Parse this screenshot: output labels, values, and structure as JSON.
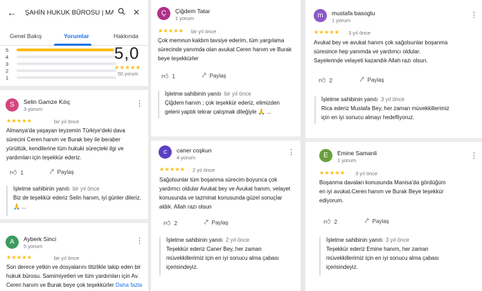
{
  "search": {
    "query": "ŞAHİN HUKUK BÜROSU | MAN"
  },
  "tabs": [
    "Genel Bakış",
    "Yorumlar",
    "Hakkında"
  ],
  "rating": {
    "score": "5,0",
    "stars": "★★★★★",
    "count": "50 yorum",
    "bars": [
      {
        "label": "5",
        "fill": 0.97
      },
      {
        "label": "4",
        "fill": 0
      },
      {
        "label": "3",
        "fill": 0
      },
      {
        "label": "2",
        "fill": 0
      },
      {
        "label": "1",
        "fill": 0
      }
    ]
  },
  "labels": {
    "like": "Beğen",
    "share": "Paylaş",
    "owner": "İşletme sahibinin yanıtı",
    "more": "Daha fazla"
  },
  "colors": {
    "accent": "#1a73e8",
    "star": "#fbbc04"
  },
  "reviews": [
    {
      "initial": "S",
      "color": "#d3457f",
      "name": "Selin Gamze Kılıç",
      "count": "3 yorum",
      "stars": "★★★★★",
      "when": "bir yıl önce",
      "text": [
        "Almanya'da yaşayan teyzemin Türkiye'deki dava",
        "sürecini Ceren hanım ve Burak bey ile beraber",
        "yürüttük, kendilerine tüm hukuki süreçteki ilgi ve",
        "yardımları için teşekkür ederiz."
      ],
      "likes": "1",
      "reply_when": "bir yıl önce",
      "reply": [
        "Biz de teşekkür ederiz Selin hanım, iyi günler dileriz.",
        "🙏 ..."
      ]
    },
    {
      "initial": "A",
      "color": "#3c9a5f",
      "name": "Ayberk Sinci",
      "count": "5 yorum",
      "stars": "★★★★★",
      "when": "bir yıl önce",
      "text": [
        "Son derece yetkin ve dosyalarını titizlikle takip eden bir",
        "hukuk bürosu. Samimiyetleri ve tüm yardımları için Av.",
        "Ceren hanım ve Burak beye çok teşekkürler"
      ]
    },
    {
      "initial": "Ç",
      "color": "#b0308a",
      "name": "Çiğdem Tatar",
      "count": "1 yorum",
      "stars": "★★★★★",
      "when": "bir yıl önce",
      "text": [
        "Çok memnun kaldım tavsiye ederim, tüm yargılama",
        "sürecinde yanımda olan avukat Ceren hanım ve Burak",
        "beye teşekkürler"
      ],
      "likes": "1",
      "reply_when": "bir yıl önce",
      "reply": [
        "Çiğdem hanım ; çok teşekkür ederiz, elimizden",
        "geleni yaptık tekrar çalışmak dileğiyle 🙏 ..."
      ]
    },
    {
      "initial": "c",
      "color": "#5b3fc4",
      "name": "caner coşkun",
      "count": "4 yorum",
      "stars": "★★★★★",
      "when": "2 yıl önce",
      "text": [
        "Sağolsunlar tüm boşanma sürecim boyunca çok",
        "yardımcı oldular Avukat bey ve Avukat hanım, velayet",
        "konusunda ve tazminat konusunda güzel sonuçlar",
        "aldık. Allah razı olsun"
      ],
      "likes": "2",
      "reply_when": "2 yıl önce",
      "reply": [
        "Teşekkür ederiz Caner Bey, her zaman",
        "müvekkillerimiz için en iyi sonucu alma çabası",
        "içerisindeyiz."
      ]
    },
    {
      "initial": "m",
      "color": "#8a58c8",
      "name": "mustafa basoglu",
      "count": "1 yorum",
      "stars": "★★★★★",
      "when": "3 yıl önce",
      "text": [
        "Avukat bey ve avukat hanım çok sağolsunlar boşanma",
        "süresince hep yanımda ve yardımcı oldular.",
        "Sayelerinde velayeti kazandık Allah razı olsun."
      ],
      "likes": "2",
      "reply_when": "3 yıl önce",
      "reply": [
        "Rica ederiz Mustafa Bey, her zaman müvekkillerimiz",
        "için en iyi sonucu almayı hedefliyoruz."
      ]
    },
    {
      "initial": "E",
      "color": "#6a9f3c",
      "name": "Emine Samanli",
      "count": "1 yorum",
      "stars": "★★★★★",
      "when": "3 yıl önce",
      "text": [
        "Boşanma davaları  konusunda Manisa'da gördüğüm",
        "en iyi avukat.Ceren hanım  ve Burak Beye teşekkür",
        "ediyorum."
      ],
      "likes": "2",
      "reply_when": "3 yıl önce",
      "reply": [
        "Teşekkür ederiz Emine hanım, her zaman",
        "müvekkillerimiz için en iyi sonucu alma çabası",
        "içerisindeyiz."
      ]
    }
  ]
}
